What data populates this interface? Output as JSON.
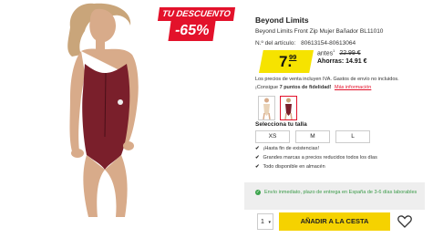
{
  "discount": {
    "label": "TU DESCUENTO",
    "percent": "-65%"
  },
  "product": {
    "brand": "Beyond Limits",
    "title": "Beyond Limits Front Zip Mujer Bañador BL11010",
    "sku_label": "N.º del artículo:",
    "sku": "80613154-80613064"
  },
  "price": {
    "integer": "7.",
    "cents": "99",
    "was_label": "antes",
    "was_value": "22.99 €",
    "savings": "Ahorras: 14.91 €"
  },
  "notes": {
    "vat": "Los precios de venta incluyen IVA. Gastos de envío no incluidos.",
    "points_prefix": "¡Consigue",
    "points_bold": "7 puntos de fidelidad!",
    "more_info": "Más información"
  },
  "sizes": {
    "heading": "Selecciona tu talla",
    "options": [
      "XS",
      "M",
      "L"
    ]
  },
  "features": [
    "¡Hasta fin de existencias!",
    "Grandes marcas a precios reducidos todos los días",
    "Todo disponible en almacén"
  ],
  "shipping": {
    "text": "Envío inmediato, plazo de entrega en España de 3-6 días laborables"
  },
  "cart": {
    "quantity": "1",
    "add_label": "AÑADIR A LA CESTA"
  },
  "colors": {
    "accent_red": "#e3122b",
    "price_yellow": "#f6e300",
    "button_yellow": "#f5d200",
    "ship_green": "#3aa34a",
    "swimsuit": "#7a1f2b"
  },
  "icons": {
    "check": "check-icon",
    "wishlist": "heart-icon",
    "shipping": "check-circle-icon",
    "dropdown": "chevron-down-icon"
  }
}
